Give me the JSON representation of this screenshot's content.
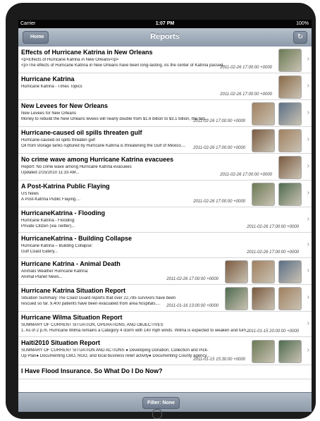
{
  "status": {
    "carrier": "Carrier",
    "time": "1:07 PM",
    "battery": "100%"
  },
  "nav": {
    "title": "Reports",
    "home": "Home"
  },
  "filter": "Filter: None",
  "rows": [
    {
      "title": "Effects of Hurricane Katrina in New Orleans",
      "s1": "<p>Effects of Hurricane Katrina in New Orleans</p>",
      "s2": "<p>The effects of Hurricane Katrina in New Orleans have been long-lasting. As the center of Katrina passed...",
      "date": "2011-02-26 17:00:00 +0000"
    },
    {
      "title": "Hurricane Katrina",
      "s1": "Hurricane Katrina - Times Topics",
      "s2": "",
      "date": "2011-02-26 17:00:00 +0000"
    },
    {
      "title": "New Levees for New Orleans",
      "s1": "New Levees for New Orleans",
      "s2": "Money to rebuild the New Orleans levees will nearly double from $1.6 billion to $3.1 billion, the fed...",
      "date": "2011-02-26 17:00:00 +0000"
    },
    {
      "title": "Hurricane-caused oil spills threaten gulf",
      "s1": "Hurricane-caused oil spills threaten gulf",
      "s2": "Oil from storage tanks ruptured by Hurricane Katrina is threatening the Gulf of Mexico....",
      "date": "2011-02-26 17:00:00 +0000"
    },
    {
      "title": "No crime wave among Hurricane Katrina evacuees",
      "s1": "Report: No crime wave among Hurricane Katrina evacuees",
      "s2": "Updated 2/15/2010 11:33 AM...",
      "date": "2011-02-26 17:00:00 +0000"
    },
    {
      "title": "A Post-Katrina Public Flaying",
      "s1": "US News",
      "s2": "A Post-Katrina Public Flaying....",
      "date": "2011-02-26 17:00:00 +0000"
    },
    {
      "title": "HurricaneKatrina - Flooding",
      "s1": "Hurricane Katrina - Flooding:",
      "s2": "Private Citizen (via Twitter)...",
      "date": "2011-02-26 17:00:00 +0000"
    },
    {
      "title": "HurricaneKatrina - Building Collapse",
      "s1": "Hurricane Katrina – Building Collapse:",
      "s2": "Gulf Coast Eatery...",
      "date": "2011-02-26 17:00:00 +0000"
    },
    {
      "title": "Hurricane Katrina - Animal Death",
      "s1": "Animals Weather Hurricane Katrina:",
      "s2": "Animal Planet News...",
      "date": "2011-02-26 17:00:00 +0000"
    },
    {
      "title": "Hurricane Katrina Situation Report",
      "s1": "Situation Summary:The Coast Guard reports that over 22,785 survivors have been",
      "s2": "rescued so far. 9,400 patients have been evacuated from area hospitals....",
      "date": "2011-01-16 13:00:00 +0000"
    },
    {
      "title": "Hurricane Wilma Situation Report",
      "s1": "SUMMARY OF CURRENT SITUATION, OPERATIONS, AND OBJECTIVES",
      "s2": "1. As of 2 p.m. Hurricane Wilma remains a Category 4 storm with 140 mph winds. Wilma is expected to weaken and turn...",
      "date": "2011-01-15 20:00:00 +0000"
    },
    {
      "title": "Haiti2010 Situation Report",
      "s1": "SUMMARY OF CURRENT SITUATION AND ACTIONS ● Developing Donation, Collection and Pick-",
      "s2": "Up Plan● Documenting CBO, NGO, and local business relief activity● Documenting County agency...",
      "date": "2011-01-15 15:30:00 +0000"
    },
    {
      "title": "I Have Flood Insurance. So What Do I Do Now?",
      "s1": "",
      "s2": "",
      "date": ""
    }
  ]
}
